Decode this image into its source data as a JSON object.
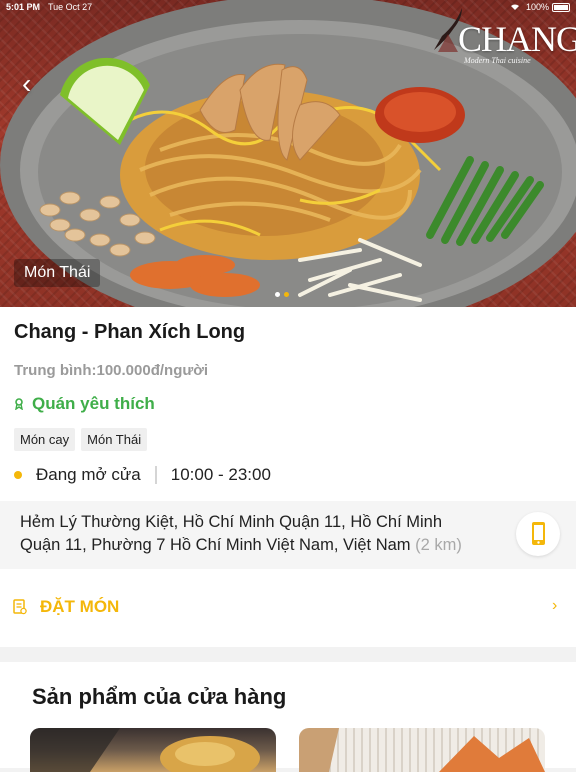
{
  "status_bar": {
    "time": "5:01 PM",
    "date": "Tue Oct 27",
    "battery": "100%"
  },
  "hero": {
    "brand_name": "CHANG",
    "brand_tagline": "Modern Thai cuisine",
    "category_badge": "Món Thái",
    "carousel": {
      "count": 2,
      "active": 1
    }
  },
  "store": {
    "name": "Chang - Phan Xích Long",
    "price_avg": "Trung bình:100.000đ/người",
    "favorite_label": "Quán yêu thích",
    "tags": [
      "Món cay",
      "Món Thái"
    ],
    "open_status": "Đang mở cửa",
    "hours": "10:00 - 23:00",
    "address_line1": "Hẻm Lý Thường Kiệt, Hồ Chí Minh Quận 11, Hồ Chí Minh",
    "address_line2": "Quận 11, Phường 7 Hồ Chí Minh Việt Nam, Việt Nam",
    "distance": "(2 km)",
    "order_label": "ĐẶT MÓN"
  },
  "products": {
    "title": "Sản phẩm của cửa hàng"
  },
  "colors": {
    "accent": "#f4b70a",
    "favorite": "#3fae49"
  },
  "icons": [
    "back-chevron-icon",
    "wifi-icon",
    "battery-icon",
    "ribbon-icon",
    "phone-icon",
    "order-icon",
    "chevron-right-icon"
  ]
}
